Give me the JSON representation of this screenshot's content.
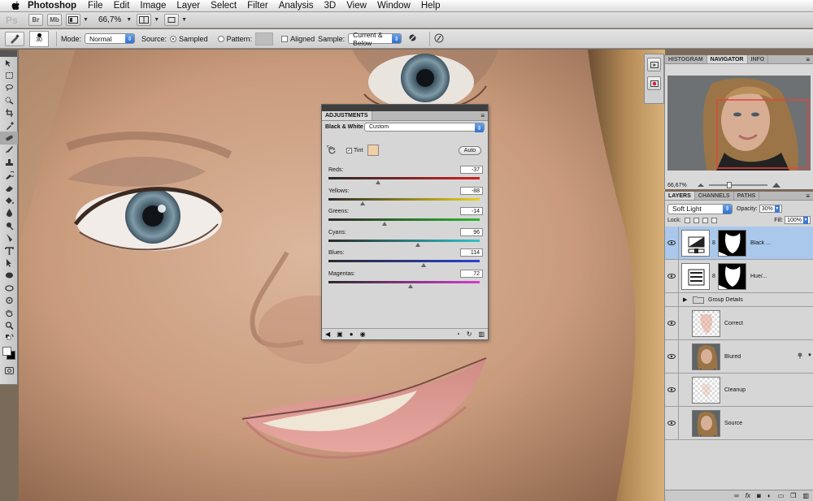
{
  "menubar": {
    "app_name": "Photoshop",
    "items": [
      "File",
      "Edit",
      "Image",
      "Layer",
      "Select",
      "Filter",
      "Analysis",
      "3D",
      "View",
      "Window",
      "Help"
    ]
  },
  "appbar": {
    "logo": "Ps",
    "bridge": "Br",
    "minibridge": "Mb",
    "zoom": "66,7%"
  },
  "options": {
    "brush_size": "30",
    "mode_label": "Mode:",
    "mode_value": "Normal",
    "source_label": "Source:",
    "sampled_label": "Sampled",
    "pattern_label": "Pattern:",
    "aligned_label": "Aligned",
    "sample_label": "Sample:",
    "sample_value": "Current & Below"
  },
  "navigator": {
    "tabs": [
      "HISTOGRAM",
      "NAVIGATOR",
      "INFO"
    ],
    "active_tab": "NAVIGATOR",
    "zoom": "66,67%"
  },
  "layers_panel": {
    "tabs": [
      "LAYERS",
      "CHANNELS",
      "PATHS"
    ],
    "active_tab": "LAYERS",
    "blend_mode": "Soft Light",
    "opacity_label": "Opacity:",
    "opacity": "30%",
    "lock_label": "Lock:",
    "fill_label": "Fill:",
    "fill": "100%",
    "layers": [
      {
        "name": "Black ...",
        "type": "adjustment",
        "selected": true
      },
      {
        "name": "Hue/...",
        "type": "adjustment",
        "selected": false
      },
      {
        "name": "Group Details",
        "type": "group",
        "selected": false
      },
      {
        "name": "Correct",
        "type": "pixel",
        "selected": false
      },
      {
        "name": "Blured",
        "type": "pixel",
        "selected": false
      },
      {
        "name": "Cleanup",
        "type": "pixel",
        "selected": false
      },
      {
        "name": "Source",
        "type": "pixel",
        "selected": false
      }
    ]
  },
  "adjustments": {
    "tab": "ADJUSTMENTS",
    "title": "Black & White",
    "preset": "Custom",
    "tint_label": "Tint",
    "tint_checked": true,
    "tint_color": "#f1cfa6",
    "auto_label": "Auto",
    "sliders": [
      {
        "name": "Reds",
        "value": "-37",
        "min": -200,
        "max": 300,
        "gradient": [
          "#2a2a2a",
          "#d02020"
        ]
      },
      {
        "name": "Yellows",
        "value": "-88",
        "min": -200,
        "max": 300,
        "gradient": [
          "#2a2a2a",
          "#e6d21c"
        ]
      },
      {
        "name": "Greens",
        "value": "-14",
        "min": -200,
        "max": 300,
        "gradient": [
          "#2a2a2a",
          "#2fb52f"
        ]
      },
      {
        "name": "Cyans",
        "value": "96",
        "min": -200,
        "max": 300,
        "gradient": [
          "#2a2a2a",
          "#2fc3c8"
        ]
      },
      {
        "name": "Blues",
        "value": "114",
        "min": -200,
        "max": 300,
        "gradient": [
          "#2a2a2a",
          "#2a3fd4"
        ]
      },
      {
        "name": "Magentas",
        "value": "72",
        "min": -200,
        "max": 300,
        "gradient": [
          "#2a2a2a",
          "#d43bd4"
        ]
      }
    ]
  },
  "colors": {
    "accent": "#3e78d6",
    "selected_layer": "#aac8ec",
    "panel_bg": "#d6d6d6",
    "nav_view_box": "#e0463a"
  }
}
